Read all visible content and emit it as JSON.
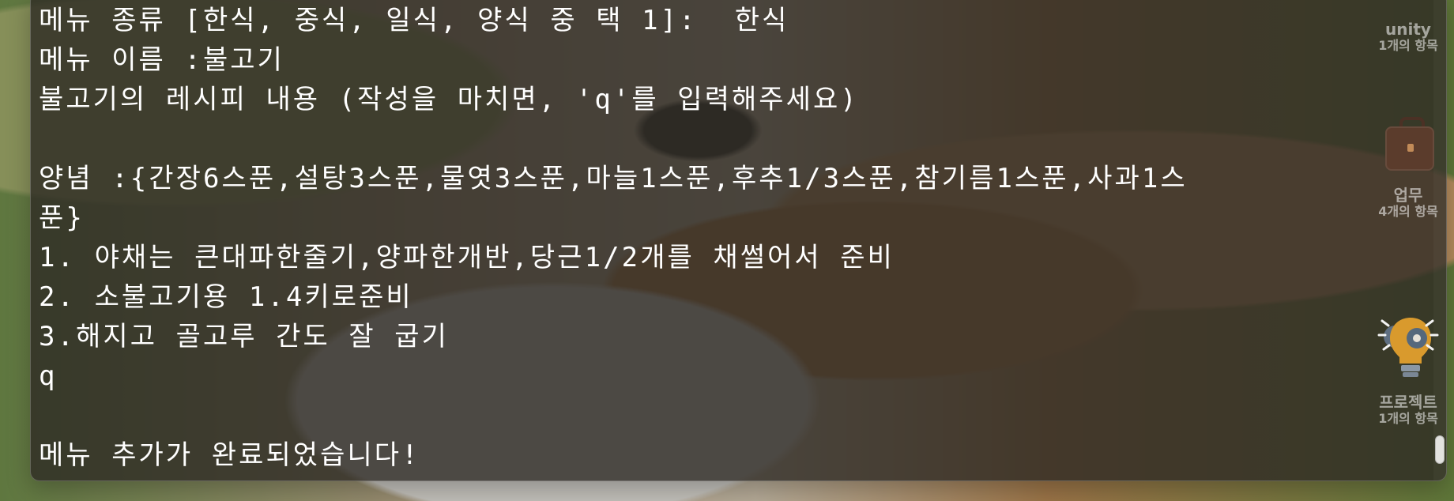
{
  "terminal": {
    "lines": [
      "메뉴 종류 [한식, 중식, 일식, 양식 중 택 1]:  한식",
      "메뉴 이름 :불고기",
      "불고기의 레시피 내용 (작성을 마치면, 'q'를 입력해주세요)",
      "",
      "양념 :{간장6스푼,설탕3스푼,물엿3스푼,마늘1스푼,후추1/3스푼,참기름1스푼,사과1스",
      "푼}",
      "1. 야채는 큰대파한줄기,양파한개반,당근1/2개를 채썰어서 준비",
      "2. 소불고기용 1.4키로준비",
      "3.해지고 골고루 간도 잘 굽기",
      "q",
      "",
      "메뉴 추가가 완료되었습니다!"
    ]
  },
  "desktop_items": {
    "unity": {
      "label": "unity",
      "count": "1개의 항목"
    },
    "work": {
      "label": "업무",
      "count": "4개의 항목"
    },
    "project": {
      "label": "프로젝트",
      "count": "1개의 항목"
    }
  },
  "icons": {
    "work_icon": "briefcase-icon",
    "project_icon": "lightbulb-gear-icon"
  },
  "colors": {
    "terminal_text": "#ffffff",
    "terminal_background": "#2c2822"
  }
}
